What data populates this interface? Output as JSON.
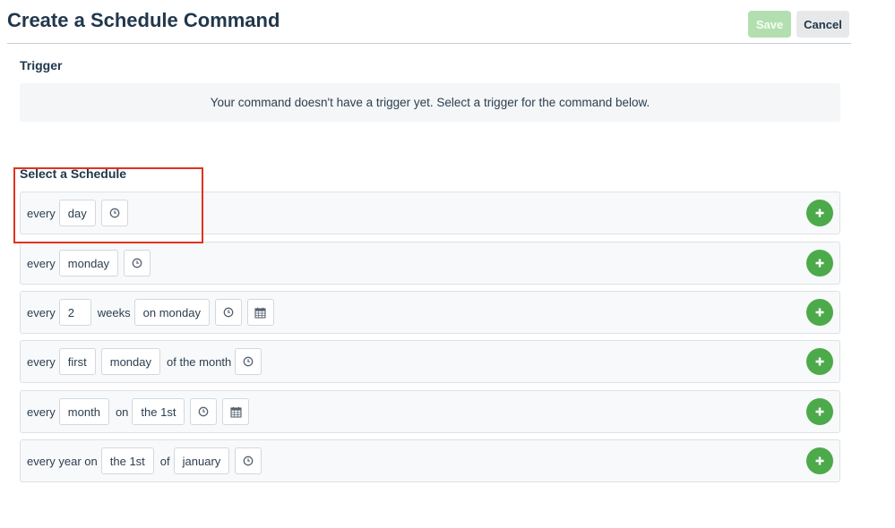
{
  "header": {
    "title": "Create a Schedule Command",
    "save_label": "Save",
    "cancel_label": "Cancel"
  },
  "trigger": {
    "heading": "Trigger",
    "message": "Your command doesn't have a trigger yet. Select a trigger for the command below."
  },
  "schedule": {
    "heading": "Select a Schedule",
    "rows": [
      {
        "every": "every",
        "unit": "day",
        "icons": [
          "clock-icon"
        ]
      },
      {
        "every": "every",
        "day": "monday",
        "icons": [
          "clock-icon"
        ]
      },
      {
        "every": "every",
        "count": "2",
        "unit_label": "weeks",
        "on": "on monday",
        "icons": [
          "clock-icon",
          "calendar-icon"
        ]
      },
      {
        "every": "every",
        "ordinal": "first",
        "day": "monday",
        "suffix": "of the month",
        "icons": [
          "clock-icon"
        ]
      },
      {
        "every": "every",
        "unit": "month",
        "on_label": "on",
        "date": "the 1st",
        "icons": [
          "clock-icon",
          "calendar-icon"
        ]
      },
      {
        "prefix": "every year on",
        "date": "the 1st",
        "of_label": "of",
        "month": "january",
        "icons": [
          "clock-icon"
        ]
      }
    ],
    "add_icon": "plus-icon"
  },
  "colors": {
    "title": "#21374b",
    "save_disabled": "#b3dfb0",
    "add_button": "#4caa4a",
    "highlight": "#e0331f"
  }
}
